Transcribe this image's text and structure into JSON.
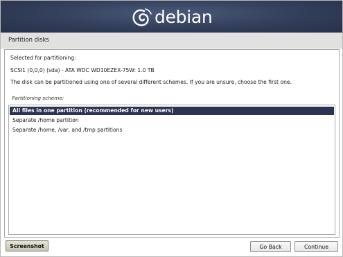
{
  "banner": {
    "logo_text": "debian"
  },
  "header": {
    "title": "Partition disks"
  },
  "content": {
    "selected_label": "Selected for partitioning:",
    "disk": "SCSI1 (0,0,0) (sda) - ATA WDC WD10EZEX-75W: 1.0 TB",
    "description": "The disk can be partitioned using one of several different schemes. If you are unsure, choose the first one.",
    "scheme_label": "Partitioning scheme:",
    "options": [
      {
        "label": "All files in one partition (recommended for new users)",
        "selected": true
      },
      {
        "label": "Separate /home partition",
        "selected": false
      },
      {
        "label": "Separate /home, /var, and /tmp partitions",
        "selected": false
      }
    ]
  },
  "buttons": {
    "screenshot": "Screenshot",
    "go_back": "Go Back",
    "continue": "Continue"
  },
  "colors": {
    "banner": "#323e5a",
    "selection": "#2d3452",
    "header_bar": "#e1e1e1"
  }
}
